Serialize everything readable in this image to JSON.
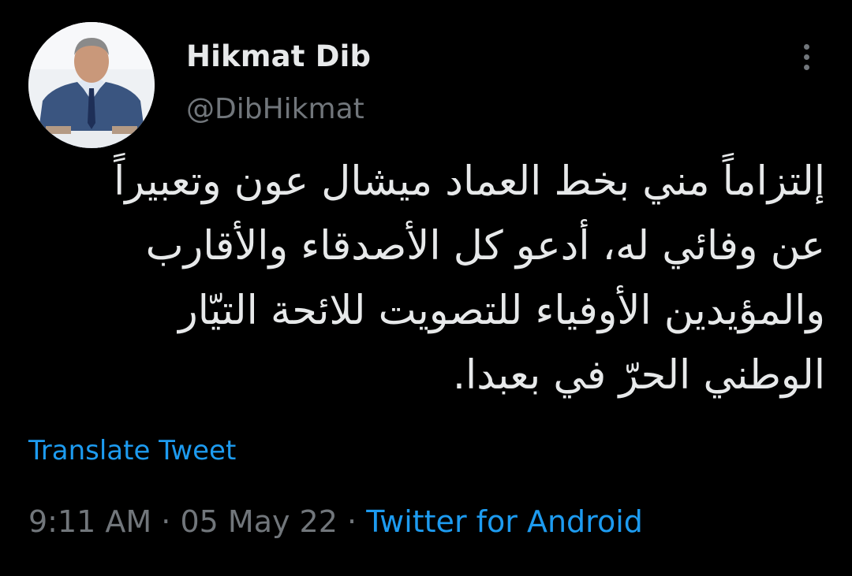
{
  "author": {
    "name": "Hikmat Dib",
    "handle": "@DibHikmat"
  },
  "tweet": {
    "lines": [
      "إلتزاماً مني بخط العماد ميشال عون وتعبيراً",
      "عن وفائي له، أدعو كل الأصدقاء والأقارب",
      "والمؤيدين الأوفياء للتصويت للائحة التيّار",
      "الوطني الحرّ في بعبدا."
    ],
    "translate_label": "Translate Tweet",
    "time": "9:11 AM",
    "date": "05 May 22",
    "separator": "·",
    "source": "Twitter for Android"
  },
  "colors": {
    "background": "#000000",
    "primary_text": "#e7e9ea",
    "secondary_text": "#71767b",
    "link": "#1d9bf0"
  },
  "icons": {
    "more": "vertical-ellipsis-icon"
  }
}
